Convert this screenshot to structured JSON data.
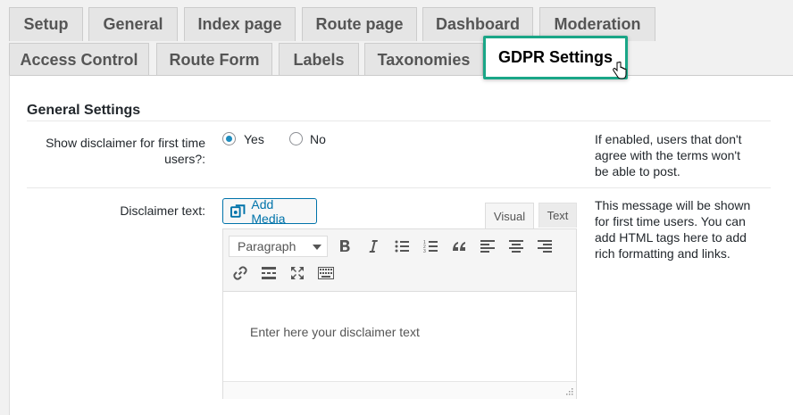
{
  "tabs_row1": [
    {
      "label": "Setup"
    },
    {
      "label": "General"
    },
    {
      "label": "Index page"
    },
    {
      "label": "Route page"
    },
    {
      "label": "Dashboard"
    },
    {
      "label": "Moderation"
    }
  ],
  "tabs_row2": [
    {
      "label": "Access Control"
    },
    {
      "label": "Route Form"
    },
    {
      "label": "Labels"
    },
    {
      "label": "Taxonomies"
    },
    {
      "label": "GDPR Settings",
      "active": true
    }
  ],
  "colors": {
    "active_tab_border": "#1aa687",
    "link_blue": "#0073aa",
    "radio_checked": "#1e8cbe"
  },
  "section": {
    "title": "General Settings"
  },
  "disclaimer_toggle": {
    "label": "Show disclaimer for first time users?:",
    "options": [
      {
        "label": "Yes",
        "checked": true
      },
      {
        "label": "No",
        "checked": false
      }
    ],
    "help": "If enabled, users that don't agree with the terms won't be able to post."
  },
  "disclaimer_text": {
    "label": "Disclaimer text:",
    "add_media_label": "Add Media",
    "editor_tabs": [
      "Visual",
      "Text"
    ],
    "format_select": "Paragraph",
    "toolbar_icons": [
      "bold-icon",
      "italic-icon",
      "bulleted-list-icon",
      "numbered-list-icon",
      "blockquote-icon",
      "align-left-icon",
      "align-center-icon",
      "align-right-icon",
      "link-icon",
      "read-more-icon",
      "fullscreen-icon",
      "toolbar-toggle-icon"
    ],
    "placeholder": "Enter here your disclaimer text",
    "help": "This message will be shown for first time users. You can add HTML tags here to add rich formatting and links."
  }
}
